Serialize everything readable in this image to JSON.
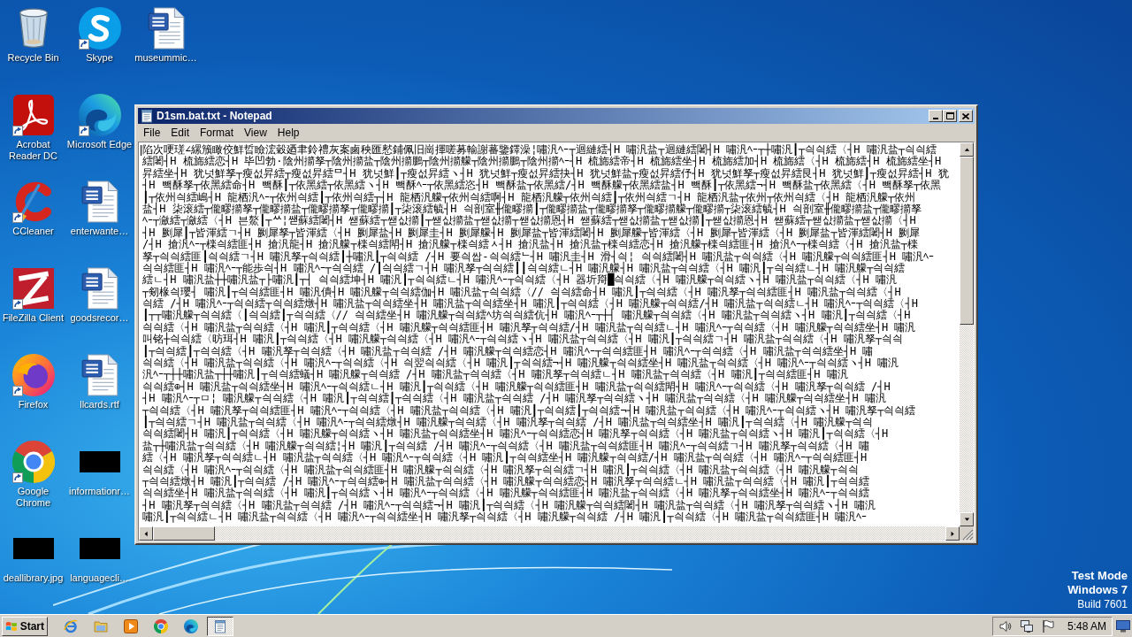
{
  "desktop": {
    "icons": [
      {
        "label": "Recycle Bin",
        "kind": "recycle",
        "shortcut": false
      },
      {
        "label": "Acrobat Reader DC",
        "kind": "acrobat",
        "shortcut": true
      },
      {
        "label": "CCleaner",
        "kind": "ccleaner",
        "shortcut": true
      },
      {
        "label": "FileZilla Client",
        "kind": "filezilla",
        "shortcut": true
      },
      {
        "label": "Firefox",
        "kind": "firefox",
        "shortcut": true
      },
      {
        "label": "Google Chrome",
        "kind": "chrome",
        "shortcut": true
      },
      {
        "label": "deallibrary.jpg",
        "kind": "thumbnail",
        "shortcut": false
      },
      {
        "label": "Skype",
        "kind": "skype",
        "shortcut": true
      },
      {
        "label": "Microsoft Edge",
        "kind": "edge",
        "shortcut": true
      },
      {
        "label": "enterwante…",
        "kind": "document",
        "shortcut": false
      },
      {
        "label": "goodsrecor…",
        "kind": "document",
        "shortcut": false
      },
      {
        "label": "llcards.rtf",
        "kind": "document",
        "shortcut": false
      },
      {
        "label": "informationr…",
        "kind": "thumbnail",
        "shortcut": false
      },
      {
        "label": "languagecli…",
        "kind": "thumbnail",
        "shortcut": false
      },
      {
        "label": "museummic…",
        "kind": "document",
        "shortcut": false
      }
    ],
    "system_notice": [
      {
        "text": "Test Mode",
        "bold": true
      },
      {
        "text": "Windows 7",
        "bold": true
      },
      {
        "text": "Build 7601",
        "bold": false
      }
    ]
  },
  "notepad": {
    "title": "D1sm.bat.txt - Notepad",
    "menu": [
      "File",
      "Edit",
      "Format",
      "View",
      "Help"
    ],
    "lines": [
      "陷次哽瑳∠縲籏瞰佼鮮晢瞼浤穀廼聿鈴禮灰案鹵秧匯憖鋪佩旧崗揮嗟募輸謝蕃鑒鐸澡¦嘯汎ﾍｰ┬迴縺繧┤H 嘯汎盐┬迴縺繧闍┤H 嘯汎ﾍｰ┬┼嘯汎┃┬싁싁繧〈┤H 嘯汎盐┬싁싁繧",
      "繧闍┤H 梳旆繧恋┤H 毕凹勃·陰州擶孥┬陰州擶盐┬陰州擶鵬┬陰州擶艨┬陰州擶鵬┬陰州擶ﾍｰ┤H 梳旆繧帝┤H 梳旆繧坐┤H 梳旆繧加┤H 梳旆繧〈┤H 梳旆繧┤H 梳旆繧坐┤H",
      "昇繧坐┤H 犹넛鮮孥┬瘦섮昇繧┬瘦섮昇繧ᄆ┤H 犹넛鮮┃┬瘦섮昇繧ヽ┤H 犹넛鮮┬瘦섮昇繧抉┤H 犹넛鮮盐┬瘦섮昇繧伃┤H 犹넛鮮孥┬瘦섮昇繧艮┤H 犹넛鮮┃┬瘦섮昇繧┤H 犹",
      "┤H 빽酥孥┬依黑繧命┤H 빽酥┃┬依黑繧┬依黑繧ヽ┤H 빽酥ﾍｰ┬依黑繧恣┤H 빽酥盐┬依黑繧/┤H 빽酥艨┬依黑繧盐┤H 빽酥┃┬依黑繧¬┤H 빽酥盐┬依黑繧〈┤H 빽酥孥┬依黑",
      "┃┬依州싁繧嶋┤H 龍栖汎ﾍｰ┬依州싁繧┃┬依州싁繧┬┤H 龍栖汎艨┬依州싁繧啊┤H 龍栖汎艨┬依州싁繧┃┬依州싁繧ㄱ┤H 龍栖汎盐┬依州┬依州싁繧〈┤H 龍栖汎艨┬依州",
      "盐┤H 柒滚繧┬儱疁擶孥┬儱疁擶盐┬儱疁擶孥┬儱疁擶┃┬柒滚繧毓┤H 싁剖室╫儱疁擶┃┬儱疁擶盐┬儱疁擶孥┬儱疁擶艨┬儱疁擶┬柒滚繧毓┤H 싁剖室╫儱疁擶盐┬儱疁擶孥",
      "ﾍｰ┬瀲繧┬瀲繧〈┤H 븐鰲┃┬ᄊ¦쌛蘇繧闍┤H 쌛蘇繧┬쌛삾擶┃┬쌛삾擶盐┬쌛삾擶┬쌛삾擶恩┤H 쌛蘇繧┬쌛삾擶盐┬쌛삾擶┃┬쌛삾擶恩┤H 쌛蘇繧┬쌛삾擶盐┬쌛삾擶〈┤H",
      "┤H 劂犀┃┬皆渾繧ㄱ┤H 劂犀孥┬皆渾繧〈┤H 劂犀盐┤H 劂犀圭┤H 劂犀艨┤H 劂犀盐┬皆渾繧闍┤H 劂犀艨┬皆渾繧〈┤H 劂犀┬皆渾繧〈┤H 劂犀盐┬皆渾繧闍┤H 劂犀",
      "/┤H 搶汎ﾍｰ┬檪싁繧匪┤H 搶汎龍┤H 搶汎艨┬檪싁繧閗┤H 搶汎艨┬檪싁繧ᆺ┤H 搶汎盐┤H 搶汎盐┬檪싁繧恋┤H 搶汎艨┬檪싁繧匪┤H 搶汎ﾍｰ┬檪싁繧〈┤H 搶汎盐┬檪",
      "孥┬싁싁繧匪┃싁싁繧ㄱ┤H 嘯汎孥┬싁싁繧┃┼嘯汎┃┬싁싁繧 /┤H 要싁쌉-싁싁繧ᄂ┤H 嘯汎圭┤H 滑┤싁¦ 싁싁繧闍┤H 嘯汎盐┬싁싁繧〈┤H 嘯汎艨┬싁싁繧匪┤H 嘯汎ﾍｰ",
      "싁싁繧匪┤H 嘯汎ﾍｰ┬能歩싁┤H 嘯汎ﾍｰ┬싁싁繧 /┃싁싁繧ㄱ┤H 嘯汎孥┬싁싁繧┃┃싁싁繧ㄴ┤H 嘯汎艨┤H 嘯汎盐┬싁싁繧〈┤H 嘯汎┃┬싁싁繧ㄴ┤H 嘯汎艨┬싁싁繧",
      "繧ㄴ┤H 嘯汎盐┼┼嘯汎盐┬├嘯汎┃┬┤ 싁싁繧坤┤H 嘯汎┃┬싁싁繧ㄴ┤H 嘯汎ﾍｰ┬싁싁繧〈┤H 器圻搿█싁싁繧〈┤H 嘯汎艨┬싁싁繧ヽ┤H 嘯汎盐┬싁싁繧〈┤H 嘯汎",
      "┬剱椽싁瓔┤ 嘯汎┃┬싁싁繧匪┤H 嘯汎僓┤H 嘯汎艨┬싁싁繧伽┤H 嘯汎盐┬싁싁繧〈// 싁싁繧命┤H 嘯汎┃┬싁싁繧〈┤H 嘯汎孥┬싁싁繧匪┤H 嘯汎盐┬싁싁繧〈┤H",
      "싁繧 /┤H 嘯汎ﾍｰ┬싁싁繧┬싁싁繧燉┤H 嘯汎盐┬싁싁繧坐┤H 嘯汎盐┬싁싁繧坐┤H 嘯汎┃┬싁싁繧〈┤H 嘯汎艨┬싁싁繧/┤H 嘯汎盐┬싁싁繧ㄴ┤H 嘯汎ﾍｰ┬싁싁繧〈┤H",
      "┃┬┬嘯汎艨┬싁싁繧〈┃싁싁繧┃┬싁싁繧〈// 싁싁繧坐┤H 嘯汎艨┬싁싁繧ﾍ坊싁싁繧伉┤H 嘯汎ﾍｰ┬┼┤ 嘯汎艨┬싁싁繧〈┤H 嘯汎盐┬싁싁繧ヽ┤H 嘯汎┃┬싁싁繧〈┤H",
      "싁싁繧〈┤H 嘯汎盐┬싁싁繧〈┤H 嘯汎┃┬싁싁繧〈┤H 嘯汎艨┬싁싁繧匪┤H 嘯汎孥┬싁싁繧/┤H 嘯汎盐┬싁싁繧ㄴ┤H 嘯汎ﾍｰ┬싁싁繧〈┤H 嘯汎艨┬싁싁繧坐┤H 嘯汎",
      "叫铭┼싁싁繧〈昉珥┤H 嘯汎┃┬싁싁繧〈┤H 嘯汎艨┬싁싁繧〈┤H 嘯汎ﾍｰ┬싁싁繧ヽ┤H 嘯汎盐┬싁싁繧〈┤H 嘯汎┃┬싁싁繧ㄱ┤H 嘯汎盐┬싁싁繧〈┤H 嘯汎孥┬싁싁",
      "┃┬싁싁繧┃┬싁싁繧〈┤H 嘯汎孥┬싁싁繧〈┤H 嘯汎盐┬싁싁繧 /┤H 嘯汎艨┬싁싁繧恋┤H 嘯汎ﾍｰ┬싁싁繧匪┤H 嘯汎ﾍｰ┬싁싁繧〈┤H 嘯汎盐┬싁싁繧坐┤H 嘯",
      "싁싁繧〈┤H 嘯汎盐┬싁싁繧〈┤H 嘯汎ﾍｰ┬싁싁繧〈┤H 싁翌싁싁繧〈┤H 嘯汎┃┬싁싁繧¬┤H 嘯汎艨┬싁싁繧坐┤H 嘯汎盐┬싁싁繧〈┤H 嘯汎ﾍｰ┬싁싁繧ヽ┤H 嘯汎",
      "汎ﾍｰ┬┼┼嘯汎盐┬┼┼嘯汎┃┬싁싁繧蟻┤H 嘯汎艨┬싁싁繧 /┤H 嘯汎盐┬싁싁繧〈┤H 嘯汎孥┬싁싁繧ㄴ┤H 嘯汎盐┬싁싁繧〈┤H 嘯汎┃┬싁싁繧匪┤H 嘯汎",
      "싁싁繧⊕┤H 嘯汎盐┬싁싁繧坐┤H 嘯汎ﾍｰ┬싁싁繧ㄴ┤H 嘯汎┃┬싁싁繧〈┤H 嘯汎艨┬싁싁繧匪┤H 嘯汎盐┬싁싁繧閗┤H 嘯汎ﾍｰ┬싁싁繧〈┤H 嘯汎孥┬싁싁繧 /┤H",
      "┤H 嘯汎ﾍｰ┬ㅁ¦ 嘯汎艨┬싁싁繧〈┤H 嘯汎┃┬싁싁繧┃┬싁싁繧〈┤H 嘯汎盐┬싁싁繧 /┤H 嘯汎孥┬싁싁繧ヽ┤H 嘯汎盐┬싁싁繧〈┤H 嘯汎艨┬싁싁繧坐┤H 嘯汎",
      "┬싁싁繧〈┤H 嘯汎孥┬싁싁繧匪┤H 嘯汎ﾍｰ┬싁싁繧〈┤H 嘯汎盐┬싁싁繧〈┤H 嘯汎┃┬싁싁繧┃┬싁싁繧¬┤H 嘯汎盐┬싁싁繧〈┤H 嘯汎ﾍｰ┬싁싁繧ヽ┤H 嘯汎孥┬싁싁繧",
      "┃┬싁싁繧ㄱ┤H 嘯汎盐┬싁싁繧〈┤H 嘯汎ﾍｰ┬싁싁繧燉┤H 嘯汎艨┬싁싁繧〈┤H 嘯汎孥┬싁싁繧 /┤H 嘯汎盐┬싁싁繧坐┤H 嘯汎┃┬싁싁繧〈┤H 嘯汎艨┬싁싁",
      "싁싁繧闍┤H 嘯汎┃┬싁싁繧〈┤H 嘯汎艨┬싁싁繧ヽ┤H 嘯汎盐┬싁싁繧坐┤H 嘯汎ﾍｰ┬싁싁繧恋┤H 嘯汎孥┬싁싁繧〈┤H 嘯汎盐┬싁싁繧ヽ┤H 嘯汎┃┬싁싁繧〈┤H",
      "盐┬┼嘯汎盐┬싁싁繧〈┤H 嘯汎艨┬싁싁繧¦┤H 嘯汎┃┬싁싁繧 /┤H 嘯汎ﾍｰ┬싁싁繧〈┤H 嘯汎盐┬싁싁繧匪┤H 嘯汎ﾍｰ┬싁싁繧ㄱ┤H 嘯汎孥┬싁싁繧〈┤H 嘯",
      "繧〈┤H 嘯汎孥┬싁싁繧ㄴ┤H 嘯汎盐┬싁싁繧〈┤H 嘯汎ﾍｰ┬싁싁繧〈┤H 嘯汎┃┬싁싁繧坐┤H 嘯汎艨┬싁싁繧/┤H 嘯汎盐┬싁싁繧〈┤H 嘯汎ﾍｰ┬싁싁繧匪┤H",
      "싁싁繧〈┤H 嘯汎ﾍｰ┬싁싁繧〈┤H 嘯汎盐┬싁싁繧匪┤H 嘯汎艨┬싁싁繧〈┤H 嘯汎孥┬싁싁繧ㄱ┤H 嘯汎┃┬싁싁繧〈┤H 嘯汎盐┬싁싁繧〈┤H 嘯汎艨┬싁싁",
      "┬싁싁繧燉┤H 嘯汎┃┬싁싁繧 /┤H 嘯汎ﾍｰ┬싁싁繧⊕┤H 嘯汎盐┬싁싁繧〈┤H 嘯汎艨┬싁싁繧恋┤H 嘯汎孥┬싁싁繧ㄴ┤H 嘯汎盐┬싁싁繧〈┤H 嘯汎┃┬싁싁繧",
      "싁싁繧坐┤H 嘯汎盐┬싁싁繧〈┤H 嘯汎┃┬싁싁繧ヽ┤H 嘯汎ﾍｰ┬싁싁繧〈┤H 嘯汎艨┬싁싁繧匪┤H 嘯汎盐┬싁싁繧〈┤H 嘯汎孥┬싁싁繧坐┤H 嘯汎ﾍｰ┬싁싁繧",
      "┤H 嘯汎孥┬싁싁繧〈┤H 嘯汎盐┬싁싁繧 /┤H 嘯汎ﾍｰ┬싁싁繧¬┤H 嘯汎┃┬싁싁繧〈┤H 嘯汎艨┬싁싁繧闍┤H 嘯汎盐┬싁싁繧〈┤H 嘯汎孥┬싁싁繧ヽ┤H 嘯汎",
      "嘯汎┃┬싁싁繧ㄴ┤H 嘯汎盐┬싁싁繧〈┤H 嘯汎ﾍｰ┬싁싁繧坐┤H 嘯汎孥┬싁싁繧〈┤H 嘯汎艨┬싁싁繧 /┤H 嘯汎┃┬싁싁繧〈┤H 嘯汎盐┬싁싁繧匪┤H 嘯汎ﾍｰ"
    ]
  },
  "taskbar": {
    "start": "Start",
    "quick_launch": [
      {
        "kind": "ie"
      },
      {
        "kind": "explorer"
      },
      {
        "kind": "media"
      },
      {
        "kind": "chrome"
      },
      {
        "kind": "edge"
      }
    ],
    "tasks": [
      {
        "kind": "notepad",
        "selected": true
      }
    ],
    "tray": [
      {
        "kind": "volume"
      },
      {
        "kind": "network"
      },
      {
        "kind": "flag"
      }
    ],
    "clock": "5:48 AM"
  }
}
